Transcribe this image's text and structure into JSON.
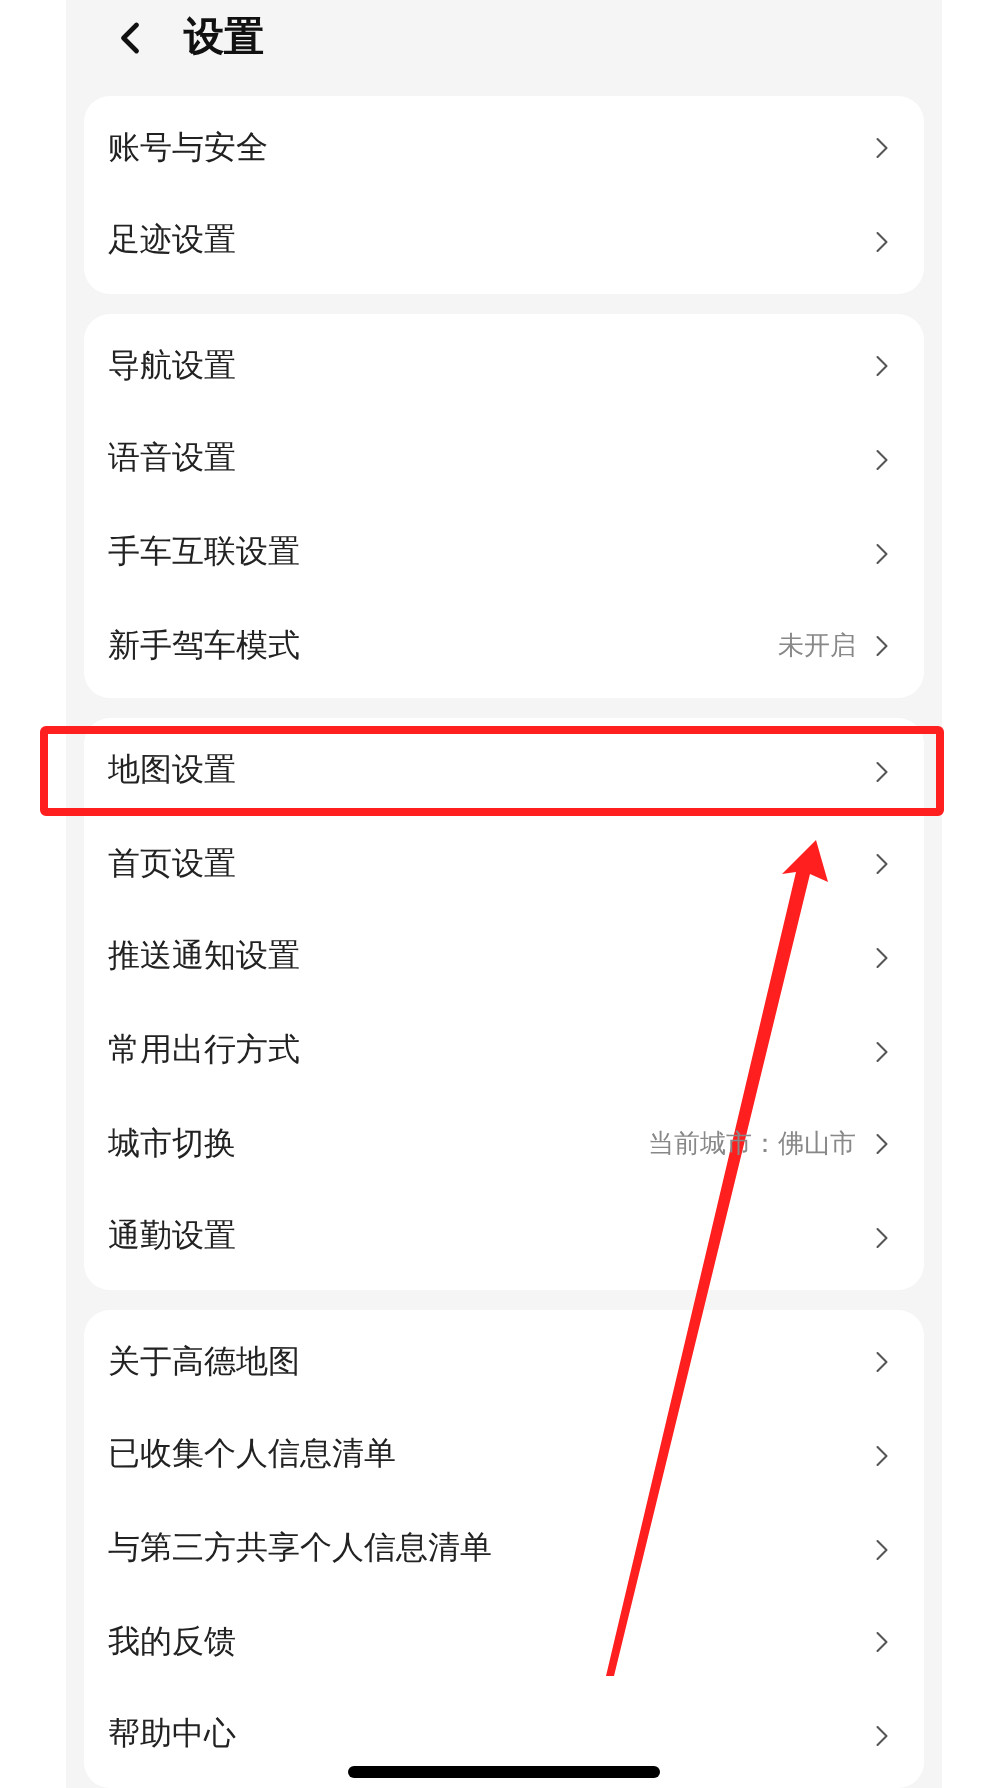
{
  "header": {
    "title": "设置"
  },
  "groups": [
    {
      "items": [
        {
          "label": "账号与安全",
          "highlighted": false
        },
        {
          "label": "足迹设置",
          "highlighted": false
        }
      ]
    },
    {
      "items": [
        {
          "label": "导航设置",
          "highlighted": false
        },
        {
          "label": "语音设置",
          "highlighted": false
        },
        {
          "label": "手车互联设置",
          "highlighted": false
        },
        {
          "label": "新手驾车模式",
          "value": "未开启",
          "highlighted": false
        }
      ]
    },
    {
      "items": [
        {
          "label": "地图设置",
          "highlighted": true
        },
        {
          "label": "首页设置",
          "highlighted": false
        },
        {
          "label": "推送通知设置",
          "highlighted": false
        },
        {
          "label": "常用出行方式",
          "highlighted": false
        },
        {
          "label": "城市切换",
          "value": "当前城市：佛山市",
          "highlighted": false
        },
        {
          "label": "通勤设置",
          "highlighted": false
        }
      ]
    },
    {
      "items": [
        {
          "label": "关于高德地图",
          "highlighted": false
        },
        {
          "label": "已收集个人信息清单",
          "highlighted": false
        },
        {
          "label": "与第三方共享个人信息清单",
          "highlighted": false
        },
        {
          "label": "我的反馈",
          "highlighted": false
        },
        {
          "label": "帮助中心",
          "highlighted": false
        }
      ]
    }
  ]
}
